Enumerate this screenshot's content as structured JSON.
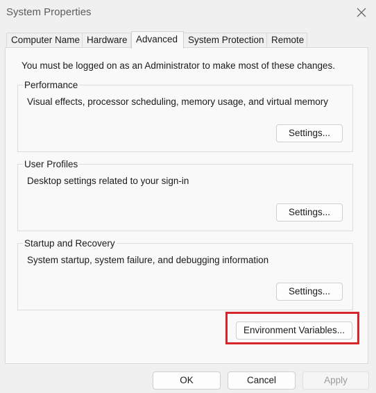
{
  "window": {
    "title": "System Properties",
    "close_icon": "close-icon"
  },
  "tabs": [
    {
      "label": "Computer Name",
      "active": false
    },
    {
      "label": "Hardware",
      "active": false
    },
    {
      "label": "Advanced",
      "active": true
    },
    {
      "label": "System Protection",
      "active": false
    },
    {
      "label": "Remote",
      "active": false
    }
  ],
  "advanced": {
    "intro": "You must be logged on as an Administrator to make most of these changes.",
    "performance": {
      "title": "Performance",
      "description": "Visual effects, processor scheduling, memory usage, and virtual memory",
      "button": "Settings..."
    },
    "user_profiles": {
      "title": "User Profiles",
      "description": "Desktop settings related to your sign-in",
      "button": "Settings..."
    },
    "startup_recovery": {
      "title": "Startup and Recovery",
      "description": "System startup, system failure, and debugging information",
      "button": "Settings..."
    },
    "env_button": "Environment Variables..."
  },
  "footer": {
    "ok": "OK",
    "cancel": "Cancel",
    "apply": "Apply"
  },
  "colors": {
    "highlight": "#d6262c"
  }
}
